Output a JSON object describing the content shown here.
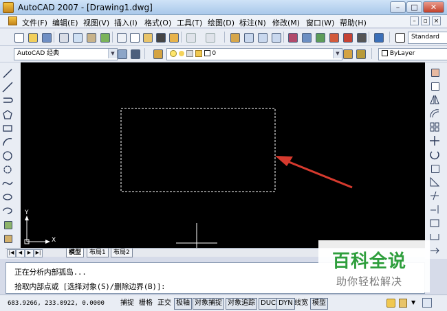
{
  "window": {
    "title": "AutoCAD 2007 - [Drawing1.dwg]",
    "minimize": "–",
    "maximize": "□",
    "close": "✕"
  },
  "menu": {
    "items": [
      "文件(F)",
      "编辑(E)",
      "视图(V)",
      "插入(I)",
      "格式(O)",
      "工具(T)",
      "绘图(D)",
      "标注(N)",
      "修改(M)",
      "窗口(W)",
      "帮助(H)"
    ],
    "mdi": [
      "–",
      "▫",
      "×"
    ]
  },
  "toolbar": {
    "text_style": "Standard",
    "workspace": "AutoCAD 经典",
    "layer": "0",
    "linetype": "ByLayer"
  },
  "drawing": {
    "ucs_y": "Y",
    "ucs_x": "X",
    "colors": {
      "background": "#000000",
      "selection": "#ffffff",
      "arrow": "#d63a2e"
    }
  },
  "layout_tabs": [
    "模型",
    "布局1",
    "布局2"
  ],
  "command": {
    "line1": "正在分析内部孤岛...",
    "line2": "拾取内部点或 [选择对象(S)/删除边界(B)]:"
  },
  "status": {
    "coords": "683.9266,  233.0922, 0.0000",
    "buttons": [
      "捕捉",
      "栅格",
      "正交",
      "极轴",
      "对象捕捉",
      "对象追踪",
      "DUCS",
      "DYN",
      "线宽",
      "模型"
    ]
  },
  "watermark": {
    "title": "百科全说",
    "subtitle": "助你轻松解决"
  }
}
